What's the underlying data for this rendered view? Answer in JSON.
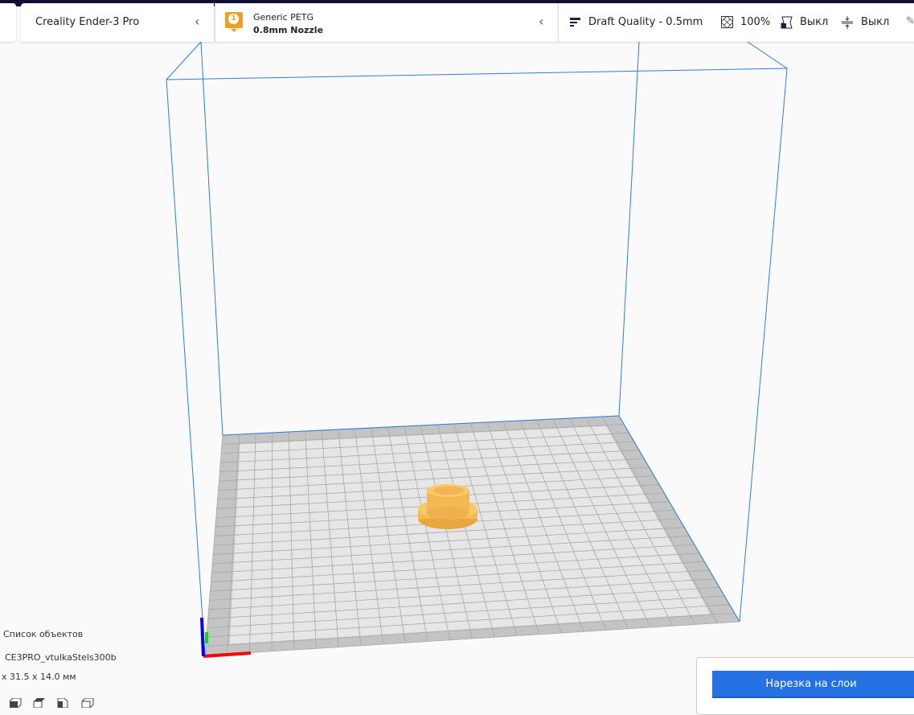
{
  "header": {
    "printer": "Creality Ender-3 Pro",
    "extruder_number": "1",
    "material": "Generic PETG",
    "nozzle": "0.8mm Nozzle",
    "quality": "Draft Quality - 0.5mm",
    "infill": "100%",
    "support": "Выкл",
    "adhesion": "Выкл"
  },
  "objects": {
    "title": "Список объектов",
    "name": "CE3PRO_vtulkaStels300b",
    "dimensions": "x 31.5 x 14.0 мм"
  },
  "actions": {
    "slice_label": "Нарезка на слои"
  },
  "colors": {
    "accent": "#2671e2",
    "model": "#f8c060",
    "build_volume": "#2f7be0",
    "badge": "#f0a020"
  }
}
